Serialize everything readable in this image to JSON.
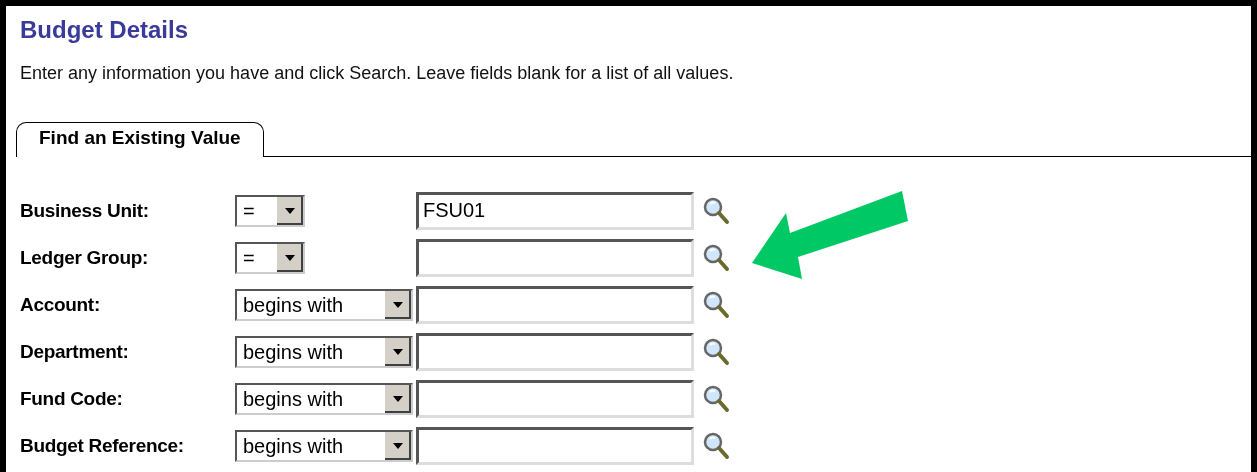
{
  "page": {
    "title": "Budget Details",
    "instructions": "Enter any information you have and click Search. Leave fields blank for a list of all values."
  },
  "tabs": [
    {
      "label": "Find an Existing Value",
      "selected": true
    }
  ],
  "fields": [
    {
      "label": "Business Unit:",
      "operator": "=",
      "value": "FSU01",
      "pointed": false
    },
    {
      "label": "Ledger Group:",
      "operator": "=",
      "pointed": true
    },
    {
      "label": "Account:",
      "operator": "begins with",
      "pointed": false
    },
    {
      "label": "Department:",
      "operator": "begins with",
      "pointed": false
    },
    {
      "label": "Fund Code:",
      "operator": "begins with",
      "pointed": false
    },
    {
      "label": "Budget Reference:",
      "operator": "begins with",
      "pointed": false
    }
  ]
}
